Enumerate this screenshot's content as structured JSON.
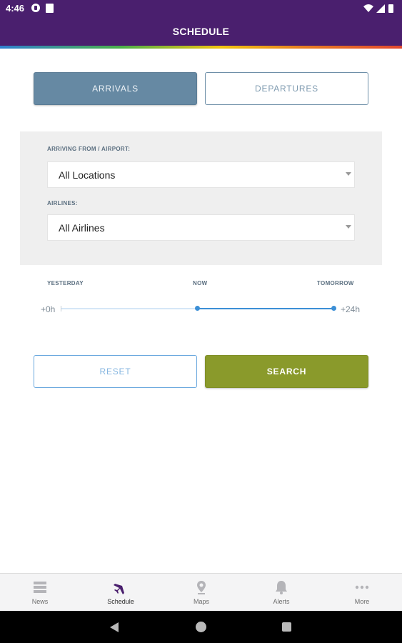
{
  "status_bar": {
    "time": "4:46"
  },
  "app_bar": {
    "title": "SCHEDULE"
  },
  "toggle": {
    "arrivals": "ARRIVALS",
    "departures": "DEPARTURES"
  },
  "filters": {
    "origin_label": "ARRIVING FROM / AIRPORT:",
    "origin_value": "All Locations",
    "airline_label": "AIRLINES:",
    "airline_value": "All Airlines"
  },
  "time_range": {
    "label_start": "YESTERDAY",
    "label_mid": "NOW",
    "label_end": "TOMORROW",
    "min_text": "+0h",
    "max_text": "+24h",
    "start_fraction": 0.5,
    "end_fraction": 1.0
  },
  "actions": {
    "reset": "RESET",
    "search": "SEARCH"
  },
  "bottom_nav": [
    {
      "label": "News",
      "icon": "news-icon"
    },
    {
      "label": "Schedule",
      "icon": "airplane-icon"
    },
    {
      "label": "Maps",
      "icon": "map-pin-icon"
    },
    {
      "label": "Alerts",
      "icon": "bell-icon"
    },
    {
      "label": "More",
      "icon": "more-dots-icon"
    }
  ],
  "colors": {
    "brand_purple": "#4a1f6e",
    "active_toggle": "#6689a3",
    "search_green": "#8a9a2b",
    "slider_blue": "#3c8fd6"
  }
}
